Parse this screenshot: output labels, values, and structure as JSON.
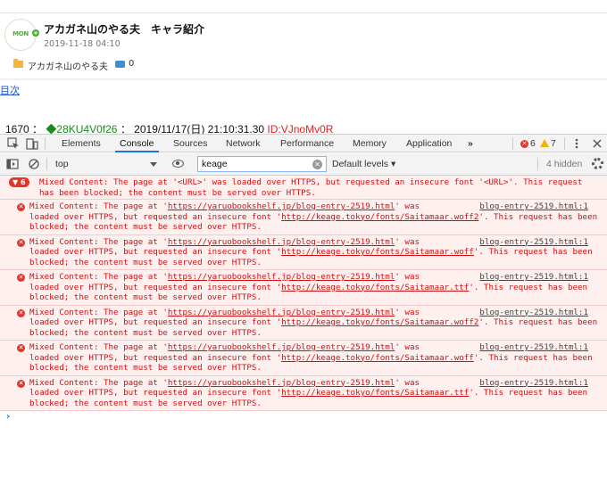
{
  "blog": {
    "logo_text": "MON",
    "title": "アカガネ山のやる夫　キャラ紹介",
    "date": "2019-11-18 04:10",
    "category": "アカガネ山のやる夫",
    "comment_count": "0",
    "toc_label": "目次",
    "res_number": "1670",
    "res_sep": "：",
    "res_trip": "◆28KU4V0f26",
    "res_sep2": "：",
    "res_datetime": "2019/11/17(日) 21:10:31.30",
    "res_id": "ID:VJnoMv0R"
  },
  "devtools": {
    "tabs": [
      "Elements",
      "Console",
      "Sources",
      "Network",
      "Performance",
      "Memory",
      "Application"
    ],
    "more_tabs": "»",
    "error_count": "6",
    "warning_count": "7",
    "context": "top",
    "filter_value": "keage",
    "levels_label": "Default levels ▾",
    "hidden_label": "4 hidden",
    "group": {
      "count": "6",
      "text": "Mixed Content: The page at '<URL>' was loaded over HTTPS, but requested an insecure font '<URL>'. This request has been blocked; the content must be served over HTTPS."
    },
    "messages": [
      {
        "page_url": "https://yaruobookshelf.jp/blog-entry-2519.html",
        "font_url": "http://keage.tokyo/fonts/Saitamaar.woff2",
        "source": "blog-entry-2519.html:1"
      },
      {
        "page_url": "https://yaruobookshelf.jp/blog-entry-2519.html",
        "font_url": "http://keage.tokyo/fonts/Saitamaar.woff",
        "source": "blog-entry-2519.html:1"
      },
      {
        "page_url": "https://yaruobookshelf.jp/blog-entry-2519.html",
        "font_url": "http://keage.tokyo/fonts/Saitamaar.ttf",
        "source": "blog-entry-2519.html:1"
      },
      {
        "page_url": "https://yaruobookshelf.jp/blog-entry-2519.html",
        "font_url": "http://keage.tokyo/fonts/Saitamaar.woff2",
        "source": "blog-entry-2519.html:1"
      },
      {
        "page_url": "https://yaruobookshelf.jp/blog-entry-2519.html",
        "font_url": "http://keage.tokyo/fonts/Saitamaar.woff",
        "source": "blog-entry-2519.html:1"
      },
      {
        "page_url": "https://yaruobookshelf.jp/blog-entry-2519.html",
        "font_url": "http://keage.tokyo/fonts/Saitamaar.ttf",
        "source": "blog-entry-2519.html:1"
      }
    ],
    "msg_parts": {
      "prefix": "Mixed Content: The page at '",
      "mid1": "' was",
      "mid2": "loaded over HTTPS, but requested an insecure font '",
      "suffix": "'. This request has been blocked; the content must be served over HTTPS."
    },
    "prompt": "›"
  },
  "colors": {
    "error_red": "#e0362b",
    "error_text": "#d01010",
    "error_bg": "#fff0f0",
    "active_tab": "#1a73e8",
    "trip_green": "#1b8a1b",
    "link_blue": "#1a55c8"
  }
}
